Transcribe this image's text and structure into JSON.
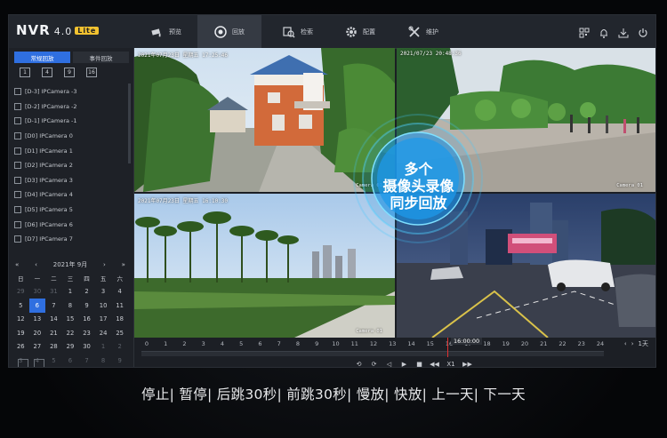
{
  "app": {
    "name": "NVR",
    "version": "4.0",
    "edition": "Lite"
  },
  "nav": [
    {
      "label": "预览",
      "icon": "camera-icon"
    },
    {
      "label": "回放",
      "icon": "playback-icon",
      "active": true
    },
    {
      "label": "检索",
      "icon": "search-icon"
    },
    {
      "label": "配置",
      "icon": "gear-icon"
    },
    {
      "label": "维护",
      "icon": "tools-icon"
    }
  ],
  "panel": {
    "tabs": [
      "常规回放",
      "事件回放"
    ],
    "splits": [
      "1",
      "4",
      "9",
      "16"
    ],
    "cameras": [
      "[D-3] IPCamera -3",
      "[D-2] IPCamera -2",
      "[D-1] IPCamera -1",
      "[D0] IPCamera 0",
      "[D1] IPCamera 1",
      "[D2] IPCamera 2",
      "[D3] IPCamera 3",
      "[D4] IPCamera 4",
      "[D5] IPCamera 5",
      "[D6] IPCamera 6",
      "[D7] IPCamera 7"
    ]
  },
  "calendar": {
    "title": "2021年 9月",
    "prev_year": "«",
    "prev_month": "‹",
    "next_month": "›",
    "next_year": "»",
    "weekdays": [
      "日",
      "一",
      "二",
      "三",
      "四",
      "五",
      "六"
    ],
    "weeks": [
      [
        "29",
        "30",
        "31",
        "1",
        "2",
        "3",
        "4"
      ],
      [
        "5",
        "6",
        "7",
        "8",
        "9",
        "10",
        "11"
      ],
      [
        "12",
        "13",
        "14",
        "15",
        "16",
        "17",
        "18"
      ],
      [
        "19",
        "20",
        "21",
        "22",
        "23",
        "24",
        "25"
      ],
      [
        "26",
        "27",
        "28",
        "29",
        "30",
        "1",
        "2"
      ],
      [
        "3",
        "4",
        "5",
        "6",
        "7",
        "8",
        "9"
      ]
    ],
    "selected": "6"
  },
  "tiles": [
    {
      "osd": "2021年07月23日 星期五 17:25:46",
      "camera": "Camera 01"
    },
    {
      "osd": "2021/07/23 20:48:36",
      "camera": "Camera 01"
    },
    {
      "osd": "2021年07月23日 星期五 16:10:30",
      "camera": "Camera 01"
    },
    {
      "osd": "",
      "camera": ""
    }
  ],
  "bubble": {
    "lines": [
      "多个",
      "摄像头录像",
      "同步回放"
    ]
  },
  "timeline": {
    "hours": [
      "0",
      "1",
      "2",
      "3",
      "4",
      "5",
      "6",
      "7",
      "8",
      "9",
      "10",
      "11",
      "12",
      "13",
      "14",
      "15",
      "16",
      "17",
      "18",
      "19",
      "20",
      "21",
      "22",
      "23",
      "24"
    ],
    "cursor_time": "16:00:00",
    "zoom_label": "1天",
    "speed_label": "X1"
  },
  "caption": "停止| 暂停| 后跳30秒| 前跳30秒| 慢放| 快放| 上一天| 下一天"
}
